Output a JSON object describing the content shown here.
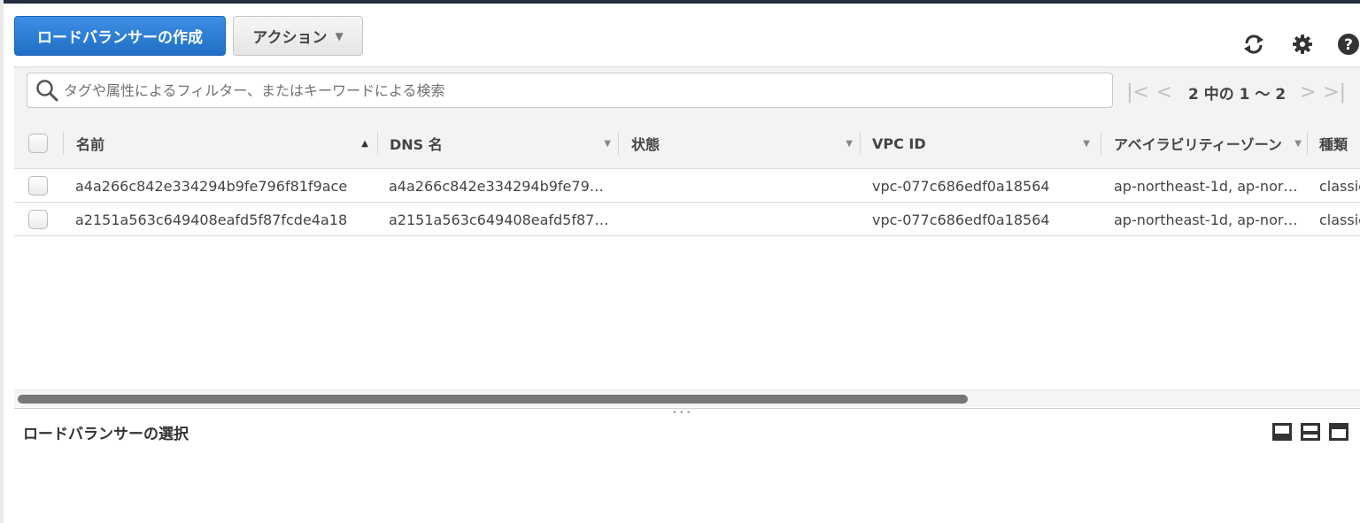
{
  "toolbar": {
    "create_label": "ロードバランサーの作成",
    "actions_label": "アクション",
    "refresh_icon": "refresh-icon",
    "settings_icon": "gear-icon",
    "help_icon": "help-icon"
  },
  "search": {
    "placeholder": "タグや属性によるフィルター、またはキーワードによる検索",
    "value": ""
  },
  "pagination": {
    "text": "2 中の 1 〜 2"
  },
  "table": {
    "columns": [
      "名前",
      "DNS 名",
      "状態",
      "VPC ID",
      "アベイラビリティーゾーン",
      "種類"
    ],
    "rows": [
      {
        "name": "a4a266c842e334294b9fe796f81f9ace",
        "dns": "a4a266c842e334294b9fe79…",
        "state": "",
        "vpc": "vpc-077c686edf0a18564",
        "az": "ap-northeast-1d, ap-nor…",
        "type": "classic"
      },
      {
        "name": "a2151a563c649408eafd5f87fcde4a18",
        "dns": "a2151a563c649408eafd5f87…",
        "state": "",
        "vpc": "vpc-077c686edf0a18564",
        "az": "ap-northeast-1d, ap-nor…",
        "type": "classic"
      }
    ]
  },
  "detail": {
    "title": "ロードバランサーの選択"
  },
  "colors": {
    "primary": "#2b7bd4",
    "header_bg": "#f2f3f3",
    "topbar": "#232f3e"
  }
}
